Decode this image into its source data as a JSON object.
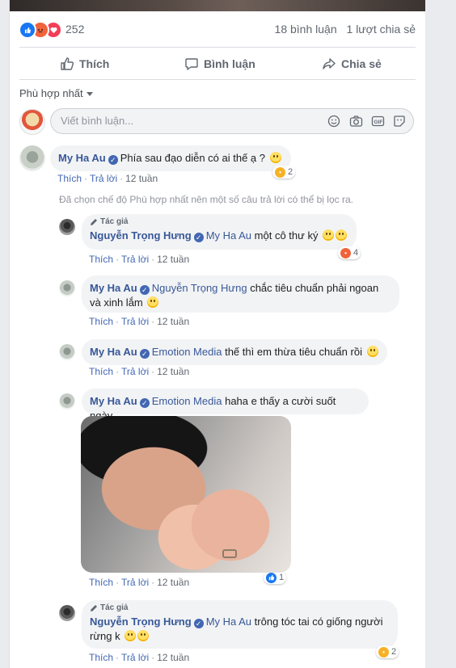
{
  "post_stats": {
    "reaction_count": "252",
    "comments": "18 bình luận",
    "shares": "1 lượt chia sẻ"
  },
  "actions": {
    "like": "Thích",
    "comment": "Bình luận",
    "share": "Chia sẻ"
  },
  "sort": {
    "label": "Phù hợp nhất"
  },
  "composer": {
    "placeholder": "Viết bình luận..."
  },
  "filter_note": "Đã chọn chế độ Phù hợp nhất nên một số câu trả lời có thể bị lọc ra.",
  "comments": [
    {
      "author": "My Ha Au",
      "text": "Phía sau đạo diễn có ai thế ạ ?",
      "reaction_count": "2",
      "like": "Thích",
      "reply": "Trả lời",
      "time": "12 tuần"
    }
  ],
  "replies": [
    {
      "badge": "Tác giả",
      "author": "Nguyễn Trọng Hưng",
      "mention": "My Ha Au",
      "text": "một cô thư ký",
      "reaction_count": "4",
      "like": "Thích",
      "reply": "Trả lời",
      "time": "12 tuần"
    },
    {
      "author": "My Ha Au",
      "mention": "Nguyễn Trọng Hưng",
      "text": "chắc tiêu chuẩn phải ngoan và xinh lắm",
      "like": "Thích",
      "reply": "Trả lời",
      "time": "12 tuần"
    },
    {
      "author": "My Ha Au",
      "mention": "Emotion Media",
      "text": "thế thì em thừa tiêu chuẩn rồi",
      "like": "Thích",
      "reply": "Trả lời",
      "time": "12 tuần"
    },
    {
      "author": "My Ha Au",
      "mention": "Emotion Media",
      "text": "haha e thấy a cười suốt ngày",
      "reaction_count": "1",
      "like": "Thích",
      "reply": "Trả lời",
      "time": "12 tuần"
    },
    {
      "badge": "Tác giả",
      "author": "Nguyễn Trọng Hưng",
      "mention": "My Ha Au",
      "text": "trông tóc tai có giống người rừng k",
      "reaction_count": "2",
      "like": "Thích",
      "reply": "Trả lời",
      "time": "12 tuần"
    }
  ],
  "colors": {
    "link": "#385898",
    "like_blue": "#1877f2",
    "angry": "#f0633b",
    "love": "#f33e58"
  }
}
